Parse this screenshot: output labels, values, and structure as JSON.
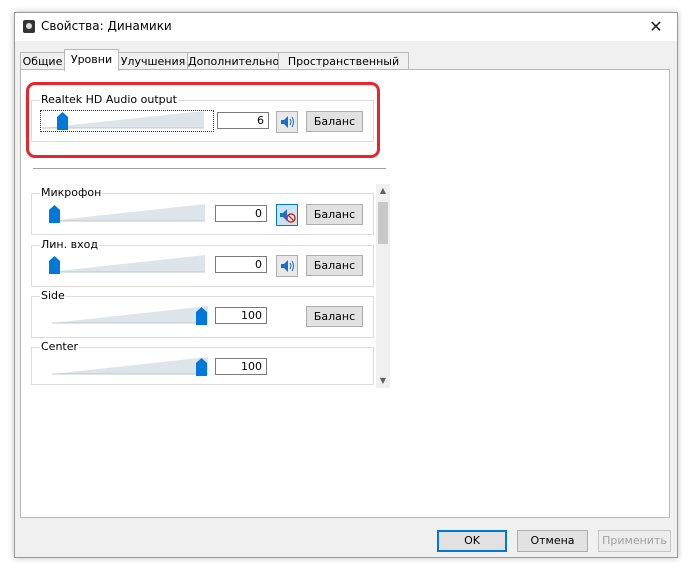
{
  "window": {
    "title": "Свойства: Динамики",
    "close_icon": "close-icon",
    "app_icon": "speaker-app-icon"
  },
  "tabs": [
    {
      "label": "Общие",
      "active": false
    },
    {
      "label": "Уровни",
      "active": true
    },
    {
      "label": "Улучшения",
      "active": false
    },
    {
      "label": "Дополнительно",
      "active": false
    },
    {
      "label": "Пространственный звук",
      "active": false
    }
  ],
  "master": {
    "label": "Realtek HD Audio output",
    "value": "6",
    "level_percent": 6,
    "muted": false,
    "speaker_icon": "speaker-icon",
    "balance_label": "Баланс"
  },
  "channels": [
    {
      "label": "Микрофон",
      "value": "0",
      "level_percent": 0,
      "has_speaker": true,
      "muted": true,
      "speaker_icon": "speaker-muted-icon",
      "balance_label": "Баланс"
    },
    {
      "label": "Лин. вход",
      "value": "0",
      "level_percent": 0,
      "has_speaker": true,
      "muted": false,
      "speaker_icon": "speaker-icon",
      "balance_label": "Баланс"
    },
    {
      "label": "Side",
      "value": "100",
      "level_percent": 100,
      "has_speaker": false,
      "balance_label": "Баланс"
    },
    {
      "label": "Center",
      "value": "100",
      "level_percent": 100,
      "has_speaker": false
    }
  ],
  "buttons": {
    "ok": "OK",
    "cancel": "Отмена",
    "apply": "Применить"
  },
  "colors": {
    "highlight": "#e8242c",
    "thumb": "#0078d7",
    "ok_border": "#0078d7"
  }
}
